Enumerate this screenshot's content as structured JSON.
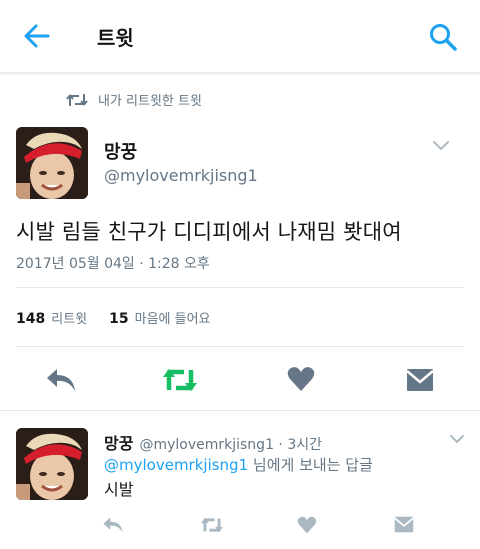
{
  "header": {
    "title": "트윗",
    "back_icon": "arrow-left-icon",
    "search_icon": "search-icon",
    "accent": "#1da1f2"
  },
  "retweet_context": {
    "label": "내가 리트윗한 트윗",
    "icon": "retweet-icon"
  },
  "tweet": {
    "display_name": "망꿍",
    "handle": "@mylovemrkjisng1",
    "text": "시발 림들 친구가 디디피에서 나재밈 봣대여",
    "timestamp": "2017년 05월 04일 · 1:28 오후",
    "stats": {
      "retweets_count": "148",
      "retweets_label": "리트윗",
      "likes_count": "15",
      "likes_label": "마음에 들어요"
    },
    "retweeted_color": "#17bf63",
    "icon_gray": "#657786",
    "actions": [
      "reply-icon",
      "retweet-icon",
      "heart-icon",
      "message-icon"
    ]
  },
  "reply": {
    "display_name": "망꿍",
    "meta": "@mylovemrkjisng1 · 3시간",
    "reply_to_handle": "@mylovemrkjisng1",
    "reply_to_suffix": " 님에게 보내는 답글",
    "text": "시발",
    "actions": [
      "reply-icon",
      "retweet-icon",
      "heart-icon",
      "message-icon"
    ]
  }
}
